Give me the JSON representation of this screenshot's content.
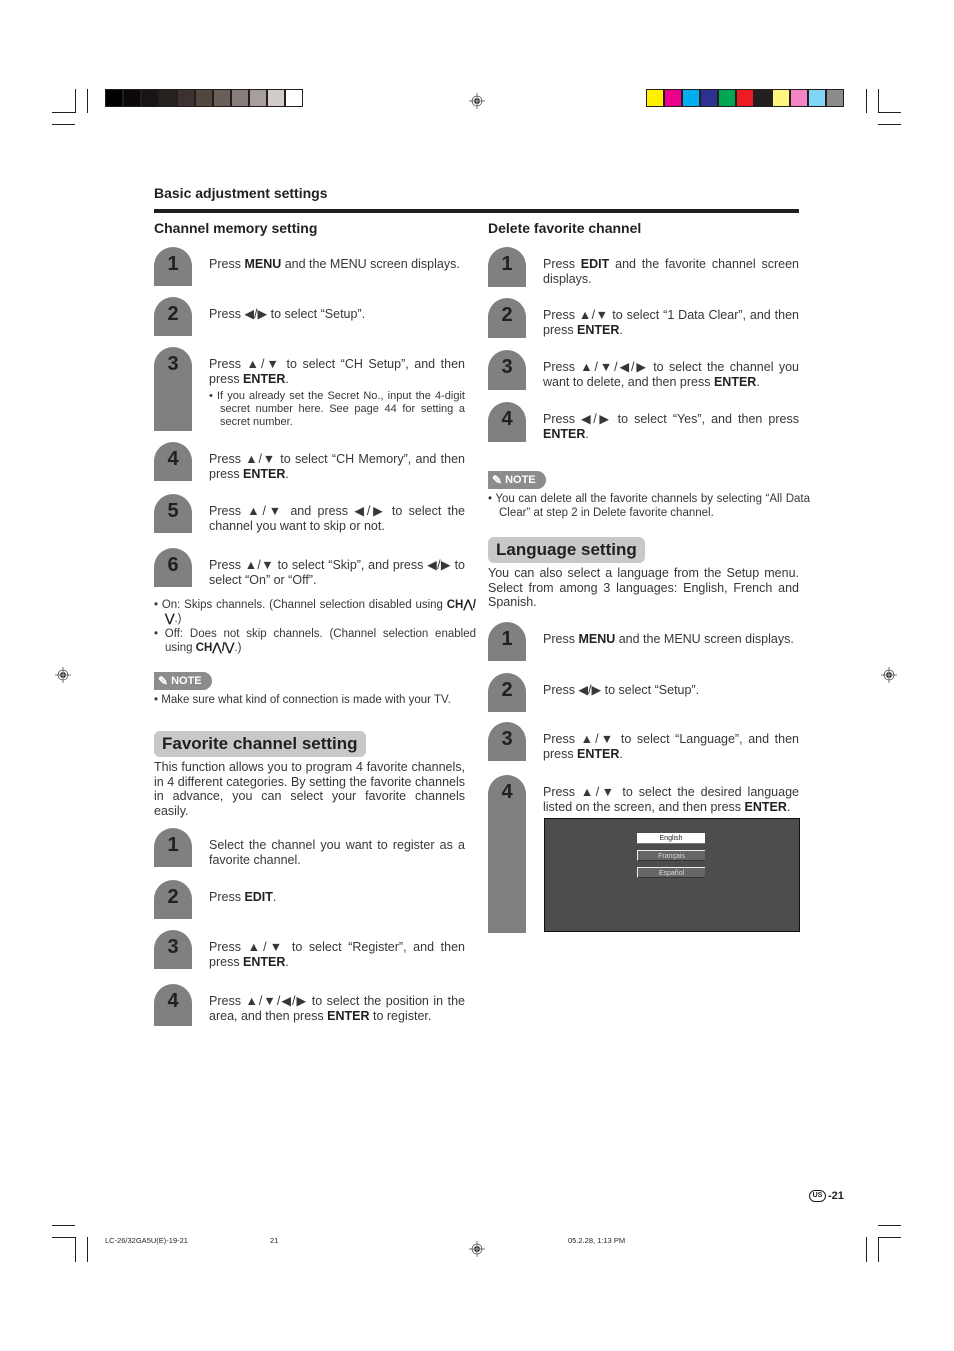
{
  "print_marks": {
    "grayscale_swatches": [
      "#000000",
      "#0b0a09",
      "#171413",
      "#26221f",
      "#3b3231",
      "#52473f",
      "#695e58",
      "#877d7a",
      "#a79f9c",
      "#d3cbc9",
      "#ffffff"
    ],
    "color_swatches": [
      "#fff200",
      "#ec008c",
      "#00aeef",
      "#2e3192",
      "#00a651",
      "#ed1c24",
      "#231f20",
      "#fff67f",
      "#f584c4",
      "#7fd6f7",
      "#8c8b8b"
    ]
  },
  "header": {
    "section_title": "Basic adjustment settings"
  },
  "channel_memory": {
    "title": "Channel memory setting",
    "steps": [
      {
        "num": "1",
        "pre": "Press ",
        "b1": "MENU",
        "post": " and the MENU screen displays."
      },
      {
        "num": "2",
        "pre": "Press ◀/▶ to select “Setup”."
      },
      {
        "num": "3",
        "pre": "Press ▲/▼ to select “CH Setup”, and then press ",
        "b1": "ENTER",
        "post": ".",
        "sub": "If you already set the Secret No., input the 4-digit secret number here. See page 44 for setting a secret number."
      },
      {
        "num": "4",
        "pre": "Press ▲/▼ to select “CH Memory”, and then press ",
        "b1": "ENTER",
        "post": "."
      },
      {
        "num": "5",
        "pre": "Press ▲/▼ and press ◀/▶ to select the channel you want to skip or not."
      },
      {
        "num": "6",
        "pre": "Press ▲/▼ to select “Skip”, and press ◀/▶ to select “On” or “Off”."
      }
    ],
    "bullets": [
      {
        "pre": "On: Skips channels. (Channel selection disabled using ",
        "ch": "CH⋀/⋁",
        "post": ".)"
      },
      {
        "pre": "Off: Does not skip channels. (Channel selection enabled using ",
        "ch": "CH⋀/⋁",
        "post": ".)"
      }
    ],
    "note_label": "NOTE",
    "note": "Make sure what kind of connection is made with your TV."
  },
  "favorite": {
    "title": "Favorite channel setting",
    "intro": "This function allows you to program 4 favorite channels, in 4 different categories. By setting the favorite channels in advance, you can select your favorite channels easily.",
    "steps": [
      {
        "num": "1",
        "pre": "Select the channel you want to register as a favorite channel."
      },
      {
        "num": "2",
        "pre": "Press ",
        "b1": "EDIT",
        "post": "."
      },
      {
        "num": "3",
        "pre": "Press ▲/▼ to select “Register”, and then press ",
        "b1": "ENTER",
        "post": "."
      },
      {
        "num": "4",
        "pre": "Press ▲/▼/◀/▶ to select the position in the area, and then press ",
        "b1": "ENTER",
        "post": " to register."
      }
    ]
  },
  "delete_favorite": {
    "title": "Delete favorite channel",
    "steps": [
      {
        "num": "1",
        "pre": "Press ",
        "b1": "EDIT",
        "post": " and the favorite channel screen displays."
      },
      {
        "num": "2",
        "pre": "Press ▲/▼ to select “1 Data Clear”, and then press ",
        "b1": "ENTER",
        "post": "."
      },
      {
        "num": "3",
        "pre": "Press ▲/▼/◀/▶ to select the channel you want to delete, and then press ",
        "b1": "ENTER",
        "post": "."
      },
      {
        "num": "4",
        "pre": "Press ◀/▶ to select “Yes”, and then press ",
        "b1": "ENTER",
        "post": "."
      }
    ],
    "note_label": "NOTE",
    "note": "You can delete all the favorite channels by selecting “All Data Clear” at step 2 in Delete favorite channel."
  },
  "language": {
    "title": "Language setting",
    "intro": "You can also select a language from the Setup menu. Select from among 3 languages: English, French and Spanish.",
    "steps": [
      {
        "num": "1",
        "pre": "Press ",
        "b1": "MENU",
        "post": " and the MENU screen displays."
      },
      {
        "num": "2",
        "pre": "Press ◀/▶ to select “Setup”."
      },
      {
        "num": "3",
        "pre": "Press ▲/▼ to select “Language”, and then press ",
        "b1": "ENTER",
        "post": "."
      },
      {
        "num": "4",
        "pre": "Press ▲/▼ to select the desired language listed on the screen, and then press ",
        "b1": "ENTER",
        "post": "."
      }
    ],
    "screen_options": [
      {
        "label": "English",
        "selected": true
      },
      {
        "label": "Français",
        "selected": false
      },
      {
        "label": "Español",
        "selected": false
      }
    ]
  },
  "footer": {
    "region_badge": "US",
    "page_number": "-21",
    "file_name": "LC-26/32GA5U(E)-19-21",
    "print_page": "21",
    "timestamp": "05.2.28, 1:13 PM"
  }
}
